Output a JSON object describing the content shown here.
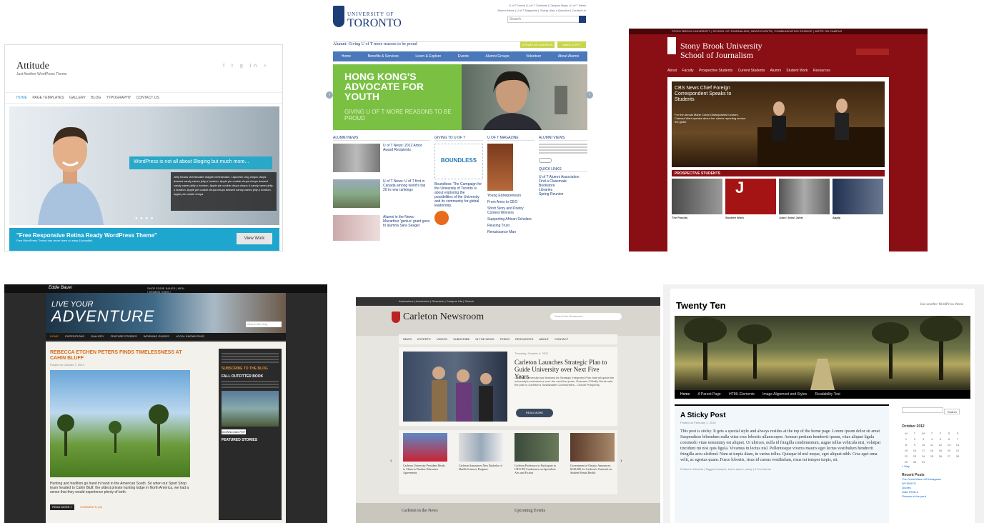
{
  "attitude": {
    "title": "Attitude",
    "tagline": "Just Another WordPress Theme",
    "nav": [
      "HOME",
      "PAGE TEMPLATES",
      "GALLERY",
      "BLOG",
      "TYPOGRAPHY",
      "CONTACT US"
    ],
    "caption": "WordPress is not all about Bloging but much more...",
    "caption_body": "Jelly beans cheesecake dragée cheesecake. Liquorice Ling chupa chups dessert candy canes jelly-o bonbon. Apple pie cookie chupa chups dessert candy canes jelly-o bonbon. Apple pie cookie chupa chups d candy canes jelly-o bonbon. Apple pie cookie chupa chups dessert candy canes jelly-o bonbon. Apple pie cookie chupa",
    "band_title": "\"Free Responsive Retina Ready WordPress Theme\"",
    "band_sub": "Free WordPress Theme has never been so easy & beautiful.",
    "view_work": "View Work"
  },
  "toronto": {
    "university_of": "UNIVERSITY OF",
    "toronto": "TORONTO",
    "top_links": "U of T Home | U of T Contacts | Campus Maps | U of T News",
    "top_links2": "Alumni News | U of T Magazine | Giving | Ask a Question | Contact Us",
    "search": "Search",
    "alumni_line": "Alumni: Giving U of T more reasons to be proud",
    "btn_update": "UPDATE MY ADDRESS",
    "btn_gift": "MAKE A GIFT",
    "nav": [
      "Home",
      "Benefits & Services",
      "Learn & Explore",
      "Events",
      "Alumni Groups",
      "Volunteer",
      "About Alumni"
    ],
    "hero_title": "HONG KONG'S ADVOCATE FOR YOUTH",
    "hero_sub": "GIVING U OF T MORE REASONS TO BE PROUD",
    "col_heads": [
      "ALUMNI NEWS",
      "GIVING TO U OF T",
      "U OF T MAGAZINE",
      "ALUMNI VIEWS"
    ],
    "news1": "U of T News: 2012 Arbor Award Recipients",
    "news2": "U of T News: U of T first in Canada among world's top 20 in new rankings",
    "news3": "Alumni in the News: Macarthur 'genius' grant goes to alumna Sara Seager",
    "boundless": "BOUNDLESS",
    "giving_text": "Boundless: The Campaign for the University of Toronto is about exploring the possibilities of the University and its community for global leadership.",
    "mag_items": [
      "Young Entrepreneurs",
      "From Arms to CEO",
      "Short Story and Poetry Contest Winners",
      "Supporting African Scholars",
      "Reusing Trust",
      "Renaissance Man"
    ],
    "quick_links": "QUICK LINKS",
    "quick_items": [
      "U of T Alumni Association",
      "Find a Classmate",
      "Bookstore",
      "Libraries",
      "Spring Reunion"
    ]
  },
  "stonybrook": {
    "top": "STONY BROOK UNIVERSITY | SCHOOL OF JOURNALISM | NEWS EVENTS | COMMUNICATING SCIENCE | WRITE ON CAMPUS",
    "brand1": "Stony Brook University",
    "brand2": "School of Journalism",
    "nav": [
      "About",
      "Faculty",
      "Prospective Students",
      "Current Students",
      "Alumni",
      "Student Work",
      "Resources"
    ],
    "hero_title": "CBS News Chief Foreign Correspondent Speaks to Students",
    "hero_body": "For the annual Marie Colvin Distinguished Lecture, Clarissa Ward speaks about her career reporting across the globe",
    "prospective": "PROSPECTIVE STUDENTS",
    "drive": "J DRIVE",
    "thumbs": [
      "The Faculty",
      "Student Work",
      "Jobs! Jobs! Jobs!",
      "Apply"
    ]
  },
  "adventure": {
    "brand": "Eddie Bauer",
    "top": "SHOP EDDIE BAUER | MEN | WOMEN | KIDS | OUTERWEAR | GEAR | SALE",
    "live": "LIVE YOUR",
    "adventure": "ADVENTURE",
    "nav": [
      "HOME",
      "EXPEDITIONS",
      "GALLERY",
      "FEATURE STORIES",
      "WORKING GUIDES",
      "LOCAL KNOWLEDGE"
    ],
    "post_title": "REBECCA ETCHEN PETERS FINDS TIMELESSNESS AT CAHIN BLUFF",
    "posted": "Posted on October 7, 2013",
    "body": "Hunting and tradition go hand in hand in the American South. So when our Sport Shop team headed to Cahin Bluff, the oldest private hunting lodge in North America, we had a sense that they would experience plenty of both.",
    "read_more": "READ MORE »",
    "comments": "COMMENTS (11)",
    "side_subscribe": "SUBSCRIBE TO THE BLOG",
    "side_catalog": "FALL OUTFITTER BOOK",
    "side_download": "DOWNLOAD PDF »",
    "side_featured": "FEATURED STORIES",
    "search_placeholder": "Search the blog"
  },
  "carleton": {
    "top": "Admissions | Academics | Research | Campus Life | Search",
    "name": "Carleton Newsroom",
    "search_placeholder": "Search the Newsroom",
    "nav": [
      "NEWS",
      "EXPERTS",
      "VIDEOS",
      "SUBSCRIBE",
      "IN THE NEWS",
      "FEEDS",
      "RESOURCES",
      "ABOUT",
      "CONTACT"
    ],
    "date": "Thursday, October 4, 2012",
    "headline": "Carleton Launches Strategic Plan to Guide University over Next Five Years",
    "body": "Carleton University has finalized its Strategic Integrated Plan that will guide the university's endeavours over the next five years. Roseann O'Reilly Runte said the plan is Carleton's Sustainable Communities – Global Prosperity.",
    "read_more": "READ MORE",
    "items": [
      "Carleton University President Heads to China to Finalize Education Agreements",
      "Carleton Announces New Bachelor of Health Sciences Program",
      "Carleton Professors to Participate in CHI-CIN Conference on Specialists Arts and Fiction",
      "Government of Ontario Announces $140,000 for Carleton's Outreach on Student Rental Health"
    ],
    "foot_left": "Carleton in the News",
    "foot_right": "Upcoming Events"
  },
  "twentyten": {
    "title": "Twenty Ten",
    "desc": "Just another WordPress theme",
    "nav": [
      "Home",
      "A Parent Page",
      "HTML Elements",
      "Image Alignment and Styles",
      "Readability Test"
    ],
    "post_title": "A Sticky Post",
    "post_date": "Posted on February 1, 2010",
    "post_body": "This post is sticky. It gets a special style and always resides at the top of the home page. Lorem ipsum dolor sit amet. Suspendisse bibendum nulla vitae eros lobortis ullamcorper. Aenean pretium hendrerit ipsum, vitae aliquet ligula commodo vitae nonummy est aliquet. Ut ultrices, nulla id fringilla condimentum, augue tellus vehicula nisi, volutpat tincidunt mi nisi quis ligula. Vivamus in lectus nisl. Pellentesque viverra mauris eget lectus vestibulum hendrerit fringilla arcu eleifend. Nam ut turpis diam, in varius tellus. Quisque id nisl neque, eget aliquet nibh. Cras eget urna velit, ac egestas quam. Fusce lobortis, risus id cursus vestibulum, risus mi tempor turpis, sit.",
    "post_meta": "Posted in General | Tagged example, lorem ipsum, sticky | 6 Comments",
    "search_btn": "Search",
    "cal_title": "October 2012",
    "cal_days": [
      "M",
      "T",
      "W",
      "T",
      "F",
      "S",
      "S"
    ],
    "cal_rows": [
      [
        "1",
        "2",
        "3",
        "4",
        "5",
        "6",
        "7"
      ],
      [
        "8",
        "9",
        "10",
        "11",
        "12",
        "13",
        "14"
      ],
      [
        "15",
        "16",
        "17",
        "18",
        "19",
        "20",
        "21"
      ],
      [
        "22",
        "23",
        "24",
        "25",
        "26",
        "27",
        "28"
      ],
      [
        "29",
        "30",
        "31",
        "",
        "",
        "",
        ""
      ]
    ],
    "prev": "« May",
    "recent_posts": "Recent Posts",
    "recent": [
      "The Great Wave off Kanagawa",
      "WYSIWYG",
      "Quotes",
      "Valid HTML5",
      "Flowers in the yard"
    ]
  }
}
